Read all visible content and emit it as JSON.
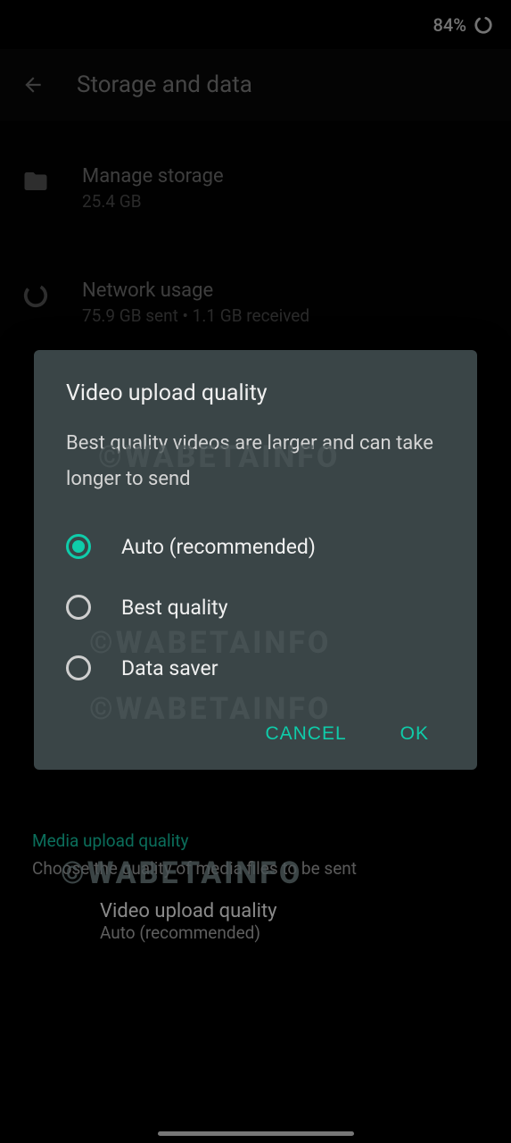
{
  "status": {
    "battery_text": "84%"
  },
  "header": {
    "title": "Storage and data"
  },
  "settings": {
    "manage_storage": {
      "title": "Manage storage",
      "sub": "25.4 GB"
    },
    "network_usage": {
      "title": "Network usage",
      "sub": "75.9 GB sent • 1.1 GB received"
    }
  },
  "section": {
    "heading": "Media upload quality",
    "sub": "Choose the quality of media files to be sent"
  },
  "sub_item": {
    "title": "Video upload quality",
    "sub": "Auto (recommended)"
  },
  "dialog": {
    "title": "Video upload quality",
    "desc": "Best quality videos are larger and can take longer to send",
    "options": {
      "auto": "Auto (recommended)",
      "best": "Best quality",
      "saver": "Data saver"
    },
    "selected": "auto",
    "cancel": "CANCEL",
    "ok": "OK"
  },
  "watermark": "©WABETAINFO"
}
